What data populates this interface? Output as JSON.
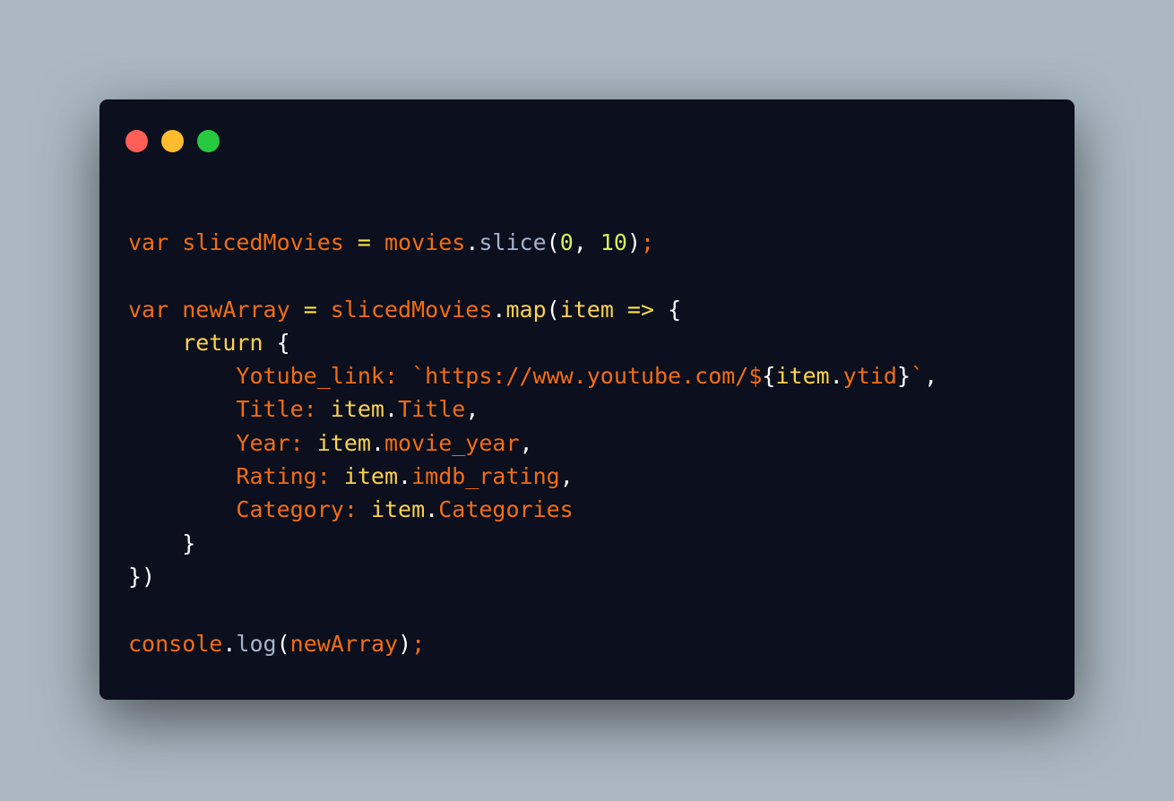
{
  "window": {
    "buttons": {
      "close_color": "#ff5f56",
      "minimize_color": "#ffbd2e",
      "maximize_color": "#27c93f"
    }
  },
  "code": {
    "lines": [
      [
        {
          "t": "var ",
          "c": "tok-key"
        },
        {
          "t": "slicedMovies ",
          "c": "tok-id"
        },
        {
          "t": "= ",
          "c": "tok-yellow"
        },
        {
          "t": "movies",
          "c": "tok-id"
        },
        {
          "t": ".",
          "c": "tok-punc"
        },
        {
          "t": "slice",
          "c": "tok-meth"
        },
        {
          "t": "(",
          "c": "tok-punc"
        },
        {
          "t": "0",
          "c": "tok-num"
        },
        {
          "t": ", ",
          "c": "tok-punc"
        },
        {
          "t": "10",
          "c": "tok-num"
        },
        {
          "t": ")",
          "c": "tok-punc"
        },
        {
          "t": ";",
          "c": "tok-key"
        }
      ],
      [],
      [
        {
          "t": "var ",
          "c": "tok-key"
        },
        {
          "t": "newArray ",
          "c": "tok-id"
        },
        {
          "t": "= ",
          "c": "tok-yellow"
        },
        {
          "t": "slicedMovies",
          "c": "tok-id"
        },
        {
          "t": ".",
          "c": "tok-punc"
        },
        {
          "t": "map",
          "c": "tok-fn"
        },
        {
          "t": "(",
          "c": "tok-punc"
        },
        {
          "t": "item ",
          "c": "tok-fn"
        },
        {
          "t": "=> ",
          "c": "tok-yellow"
        },
        {
          "t": "{",
          "c": "tok-punc"
        }
      ],
      [
        {
          "t": "    return ",
          "c": "tok-fn"
        },
        {
          "t": "{",
          "c": "tok-punc"
        }
      ],
      [
        {
          "t": "        Yotube_link: ",
          "c": "tok-key"
        },
        {
          "t": "`https://www.youtube.com/$",
          "c": "tok-str"
        },
        {
          "t": "{",
          "c": "tok-punc"
        },
        {
          "t": "item",
          "c": "tok-fn"
        },
        {
          "t": ".",
          "c": "tok-punc"
        },
        {
          "t": "ytid",
          "c": "tok-id"
        },
        {
          "t": "}",
          "c": "tok-punc"
        },
        {
          "t": "`",
          "c": "tok-str"
        },
        {
          "t": ",",
          "c": "tok-punc"
        }
      ],
      [
        {
          "t": "        Title: ",
          "c": "tok-key"
        },
        {
          "t": "item",
          "c": "tok-fn"
        },
        {
          "t": ".",
          "c": "tok-punc"
        },
        {
          "t": "Title",
          "c": "tok-id"
        },
        {
          "t": ",",
          "c": "tok-punc"
        }
      ],
      [
        {
          "t": "        Year: ",
          "c": "tok-key"
        },
        {
          "t": "item",
          "c": "tok-fn"
        },
        {
          "t": ".",
          "c": "tok-punc"
        },
        {
          "t": "movie_year",
          "c": "tok-id"
        },
        {
          "t": ",",
          "c": "tok-punc"
        }
      ],
      [
        {
          "t": "        Rating: ",
          "c": "tok-key"
        },
        {
          "t": "item",
          "c": "tok-fn"
        },
        {
          "t": ".",
          "c": "tok-punc"
        },
        {
          "t": "imdb_rating",
          "c": "tok-id"
        },
        {
          "t": ",",
          "c": "tok-punc"
        }
      ],
      [
        {
          "t": "        Category: ",
          "c": "tok-key"
        },
        {
          "t": "item",
          "c": "tok-fn"
        },
        {
          "t": ".",
          "c": "tok-punc"
        },
        {
          "t": "Categories",
          "c": "tok-id"
        }
      ],
      [
        {
          "t": "    }",
          "c": "tok-punc"
        }
      ],
      [
        {
          "t": "})",
          "c": "tok-punc"
        }
      ],
      [],
      [
        {
          "t": "console",
          "c": "tok-id"
        },
        {
          "t": ".",
          "c": "tok-punc"
        },
        {
          "t": "log",
          "c": "tok-meth"
        },
        {
          "t": "(",
          "c": "tok-punc"
        },
        {
          "t": "newArray",
          "c": "tok-id"
        },
        {
          "t": ")",
          "c": "tok-punc"
        },
        {
          "t": ";",
          "c": "tok-key"
        }
      ]
    ]
  }
}
